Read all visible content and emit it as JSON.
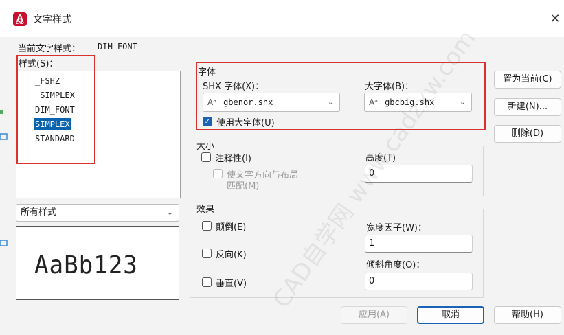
{
  "window": {
    "title": "文字样式",
    "close_glyph": "✕",
    "app_icon_letter": "A",
    "app_icon_sub": "CAD"
  },
  "current_style": {
    "label": "当前文字样式：",
    "value": "DIM_FONT"
  },
  "styles": {
    "label": "样式(S)：",
    "items": [
      "_FSHZ",
      "_SIMPLEX",
      "DIM_FONT",
      "SIMPLEX",
      "STANDARD"
    ],
    "selected_index": 3
  },
  "filter": {
    "value": "所有样式"
  },
  "preview": {
    "text": "AaBb123"
  },
  "font": {
    "group_title": "字体",
    "shx_label": "SHX 字体(X)：",
    "shx_value": "gbenor.shx",
    "big_label": "大字体(B)：",
    "big_value": "gbcbig.shx",
    "use_big_font_label": "使用大字体(U)",
    "use_big_font_checked": true
  },
  "size": {
    "group_title": "大小",
    "annotative_label": "注释性(I)",
    "match_orientation_line1": "使文字方向与布局",
    "match_orientation_line2": "匹配(M)",
    "height_label": "高度(T)",
    "height_value": "0"
  },
  "effects": {
    "group_title": "效果",
    "upside_down_label": "颠倒(E)",
    "backwards_label": "反向(K)",
    "vertical_label": "垂直(V)",
    "width_factor_label": "宽度因子(W)：",
    "width_factor_value": "1",
    "oblique_label": "倾斜角度(O)：",
    "oblique_value": "0"
  },
  "buttons": {
    "set_current": "置为当前(C)",
    "new": "新建(N)...",
    "delete": "删除(D)",
    "apply": "应用(A)",
    "cancel": "取消",
    "help": "帮助(H)"
  },
  "watermark": "CAD自学网 www.cadzxw.com",
  "colors": {
    "accent": "#1a62b6",
    "selection": "#0a64ad",
    "highlight_box": "#d8322e"
  }
}
